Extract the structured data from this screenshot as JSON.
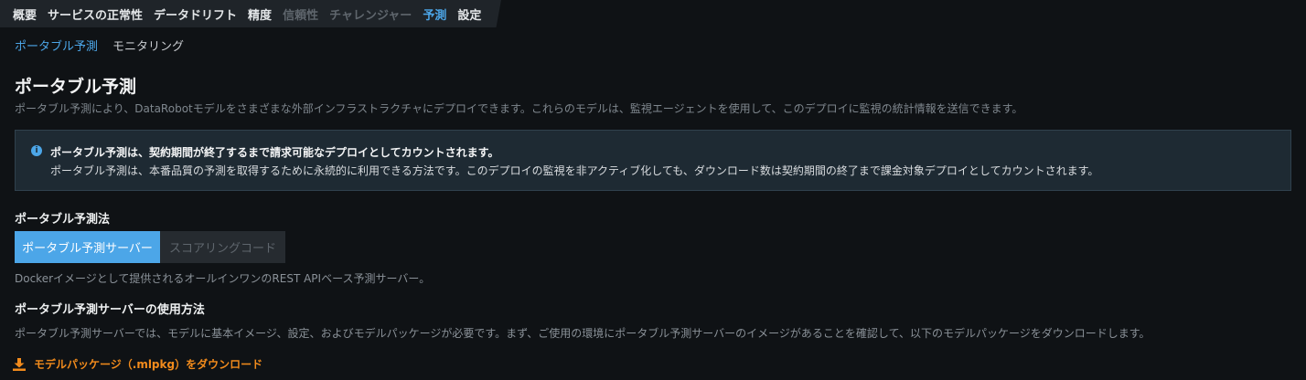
{
  "top_tabs": [
    {
      "label": "概要"
    },
    {
      "label": "サービスの正常性"
    },
    {
      "label": "データドリフト"
    },
    {
      "label": "精度"
    },
    {
      "label": "信頼性"
    },
    {
      "label": "チャレンジャー"
    },
    {
      "label": "予測"
    },
    {
      "label": "設定"
    }
  ],
  "top_tabs_state": {
    "active": "予測",
    "disabled": [
      "信頼性",
      "チャレンジャー"
    ]
  },
  "subnav": {
    "portable": "ポータブル予測",
    "monitoring": "モニタリング"
  },
  "page": {
    "title": "ポータブル予測",
    "description": "ポータブル予測により、DataRobotモデルをさまざまな外部インフラストラクチャにデプロイできます。これらのモデルは、監視エージェントを使用して、このデプロイに監視の統計情報を送信できます。"
  },
  "notice": {
    "title": "ポータブル予測は、契約期間が終了するまで請求可能なデプロイとしてカウントされます。",
    "body": "ポータブル予測は、本番品質の予測を取得するために永続的に利用できる方法です。このデプロイの監視を非アクティブ化しても、ダウンロード数は契約期間の終了まで課金対象デプロイとしてカウントされます。",
    "icon": "info-icon"
  },
  "method": {
    "label": "ポータブル予測法",
    "options": {
      "server": "ポータブル予測サーバー",
      "scoring_code": "スコアリングコード"
    },
    "selected": "ポータブル予測サーバー",
    "server_description": "Dockerイメージとして提供されるオールインワンのREST APIベース予測サーバー。"
  },
  "usage": {
    "heading": "ポータブル予測サーバーの使用方法",
    "text": "ポータブル予測サーバーでは、モデルに基本イメージ、設定、およびモデルパッケージが必要です。まず、ご使用の環境にポータブル予測サーバーのイメージがあることを確認して、以下のモデルパッケージをダウンロードします。"
  },
  "download": {
    "label": "モデルパッケージ（.mlpkg）をダウンロード",
    "icon": "download-icon"
  },
  "colors": {
    "accent": "#4ca6e8",
    "download": "#f28b1c",
    "background": "#0f1215"
  }
}
